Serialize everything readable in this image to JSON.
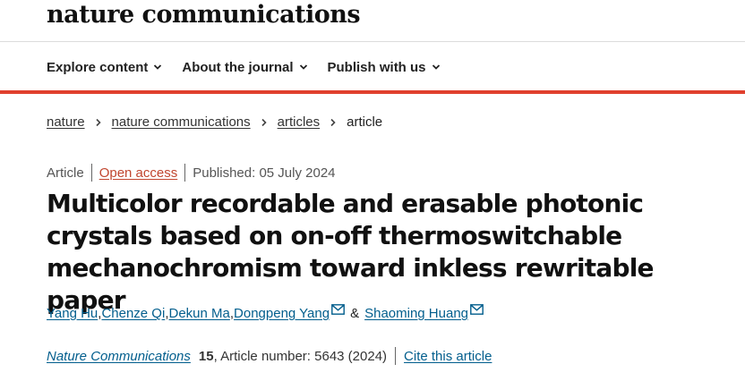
{
  "header": {
    "logo": "nature communications"
  },
  "nav": {
    "items": [
      {
        "label": "Explore content"
      },
      {
        "label": "About the journal"
      },
      {
        "label": "Publish with us"
      }
    ]
  },
  "breadcrumb": [
    "nature",
    "nature communications",
    "articles",
    "article"
  ],
  "meta": {
    "type": "Article",
    "access": "Open access",
    "published": "Published: 05 July 2024"
  },
  "article": {
    "title": "Multicolor recordable and erasable photonic crystals based on on-off thermoswitchable mechanochromism toward inkless rewritable paper",
    "authors": [
      "Yang Hu",
      "Chenze Qi",
      "Dekun Ma",
      "Dongpeng Yang",
      "Shaoming Huang"
    ],
    "author_sep": ", ",
    "author_and": "&",
    "journal": "Nature Communications",
    "volume": "15",
    "article_number": ", Article number: 5643 (2024)",
    "cite_label": "Cite this article"
  },
  "colors": {
    "accent_red": "#e0402d",
    "link_blue": "#025e8d",
    "open_access": "#c1462f"
  }
}
